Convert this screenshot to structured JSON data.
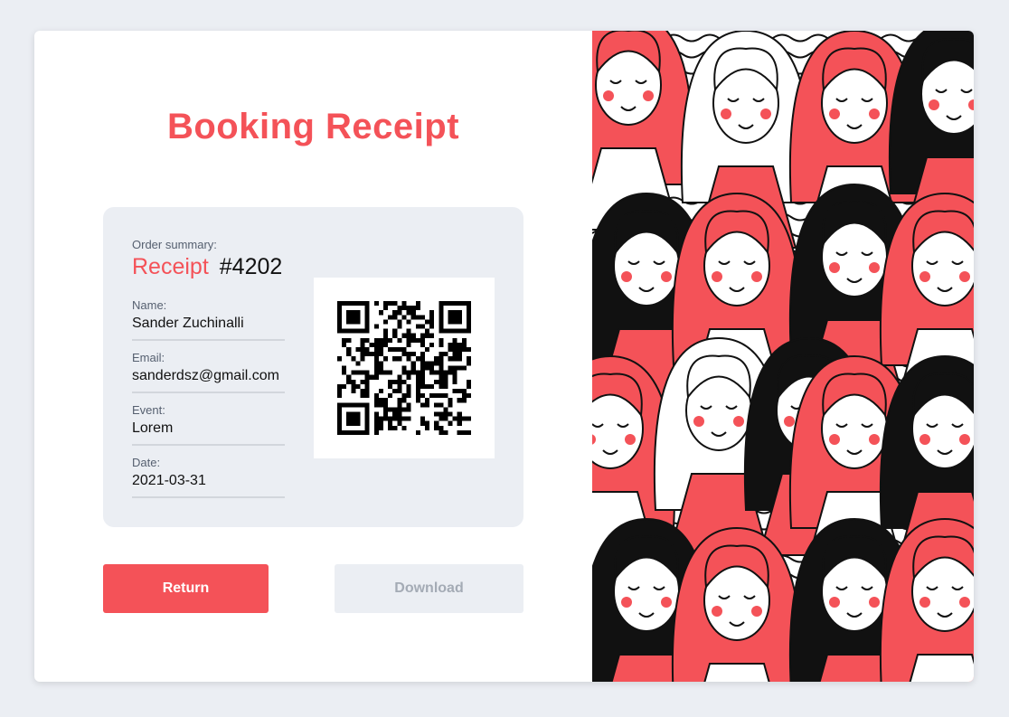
{
  "title": "Booking Receipt",
  "order": {
    "summary_label": "Order summary:",
    "receipt_word": "Receipt",
    "receipt_number": "#4202"
  },
  "fields": {
    "name": {
      "label": "Name:",
      "value": "Sander Zuchinalli"
    },
    "email": {
      "label": "Email:",
      "value": "sanderdsz@gmail.com"
    },
    "event": {
      "label": "Event:",
      "value": "Lorem"
    },
    "date": {
      "label": "Date:",
      "value": "2021-03-31"
    }
  },
  "buttons": {
    "return_label": "Return",
    "download_label": "Download"
  },
  "colors": {
    "accent": "#f45258",
    "panel_bg": "#ebeef3",
    "page_bg": "#ebeef3"
  },
  "icons": {
    "qr": "qr-code-icon"
  }
}
